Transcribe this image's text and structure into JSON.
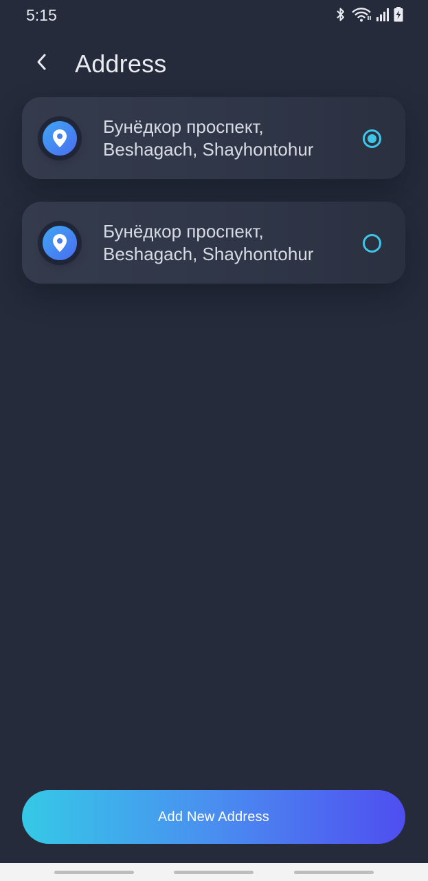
{
  "status_bar": {
    "time": "5:15",
    "icons": [
      "bluetooth-icon",
      "wifi-icon",
      "cell-signal-icon",
      "battery-charging-icon"
    ]
  },
  "header": {
    "back_icon": "chevron-left-icon",
    "title": "Address"
  },
  "addresses": [
    {
      "line1": "Бунёдкор проспект,",
      "line2": "Beshagach, Shayhontohur",
      "selected": true,
      "icon": "location-pin-icon"
    },
    {
      "line1": "Бунёдкор проспект,",
      "line2": "Beshagach, Shayhontohur",
      "selected": false,
      "icon": "location-pin-icon"
    }
  ],
  "add_button": {
    "label": "Add New Address"
  },
  "colors": {
    "background": "#252b3b",
    "card": "#343b4d",
    "accent": "#3fc6e6",
    "button_start": "#35c9e6",
    "button_end": "#4f4ef0"
  }
}
